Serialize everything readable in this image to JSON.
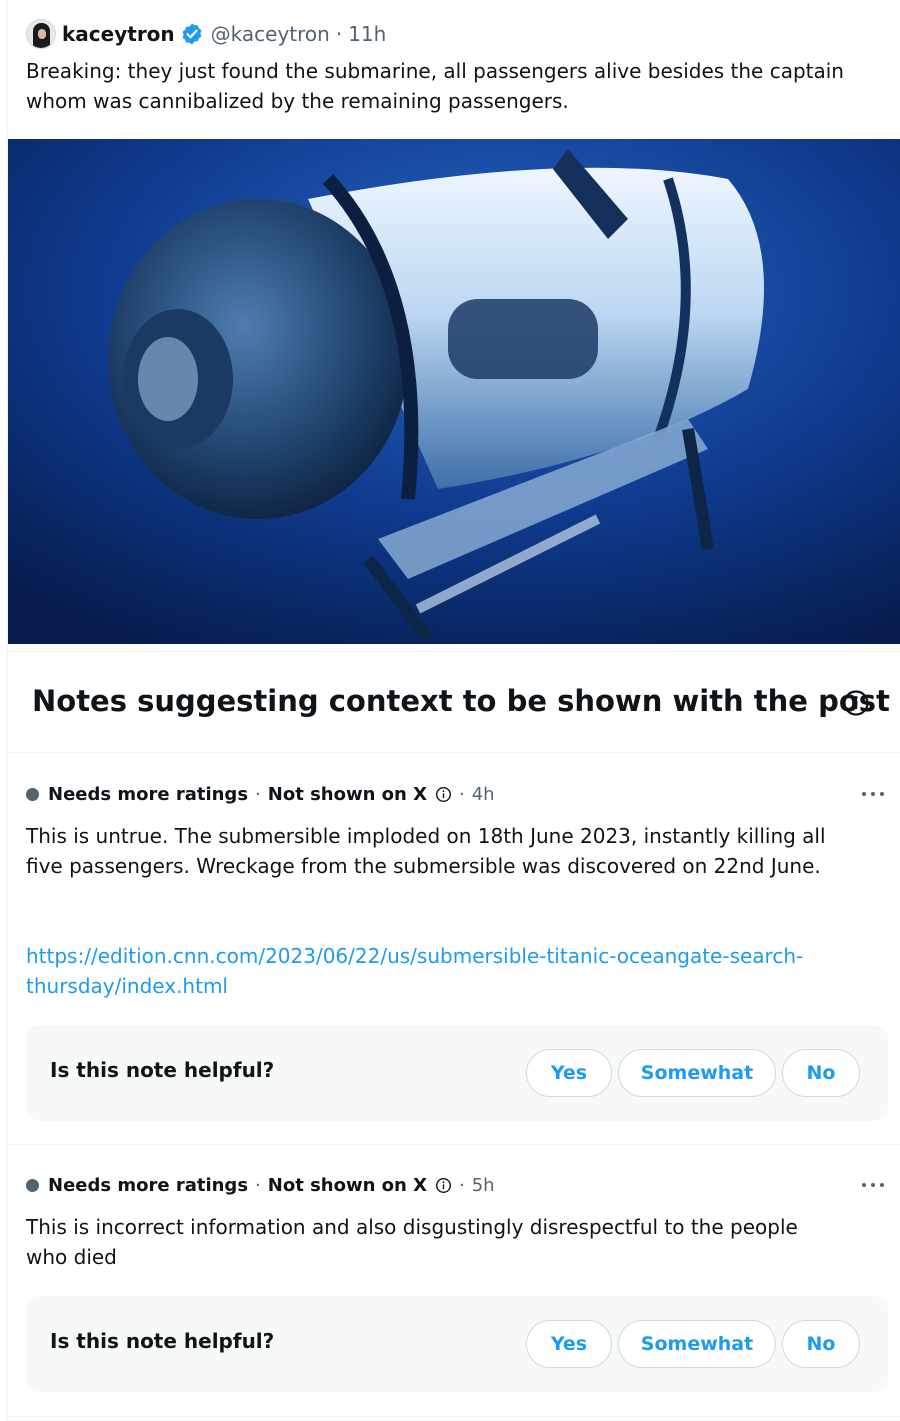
{
  "post": {
    "display_name": "kaceytron",
    "handle": "@kaceytron",
    "separator": "·",
    "time": "11h",
    "text": "Breaking: they just found the submarine, all passengers alive besides the captain whom was cannibalized by the remaining passengers.",
    "icons": {
      "avatar": "profile-avatar",
      "verified": "verified-badge-icon"
    },
    "colors": {
      "verified": "#1d9bf0"
    }
  },
  "notes_section": {
    "title": "Notes suggesting context to be shown with the post",
    "icon": "info-icon"
  },
  "notes": [
    {
      "status": "Needs more ratings",
      "separator": "·",
      "visibility": "Not shown on X",
      "time": "4h",
      "text": "This is untrue. The submersible imploded on 18th June 2023, instantly killing all five passengers. Wreckage from the submersible was discovered on 22nd June.",
      "link": "https://edition.cnn.com/2023/06/22/us/submersible-titanic-oceangate-search-thursday/index.html",
      "helpful_question": "Is this note helpful?",
      "buttons": {
        "yes": "Yes",
        "somewhat": "Somewhat",
        "no": "No"
      }
    },
    {
      "status": "Needs more ratings",
      "separator": "·",
      "visibility": "Not shown on X",
      "time": "5h",
      "text": "This is incorrect information and also disgustingly disrespectful to the people who died",
      "helpful_question": "Is this note helpful?",
      "buttons": {
        "yes": "Yes",
        "somewhat": "Somewhat",
        "no": "No"
      }
    }
  ],
  "colors": {
    "accent": "#1d9bf0",
    "text": "#0f1419",
    "secondary": "#536471",
    "box_bg": "#f7f9f9"
  }
}
